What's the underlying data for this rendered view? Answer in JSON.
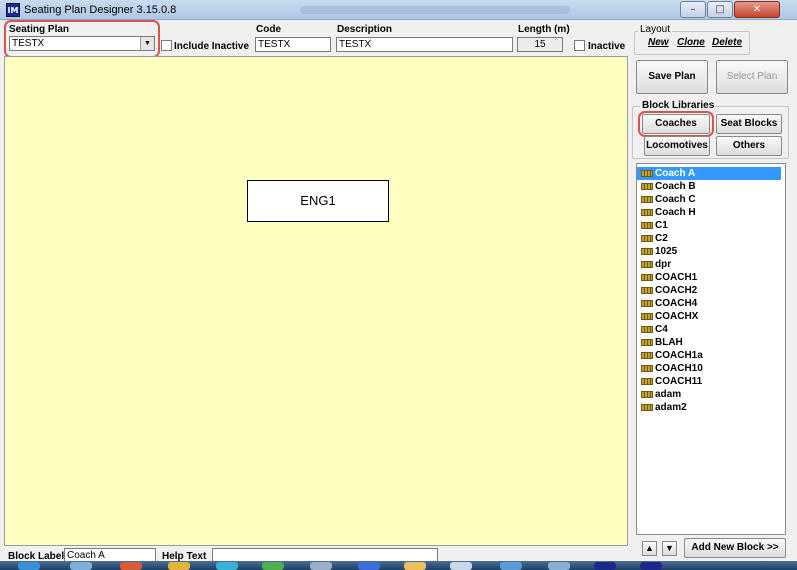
{
  "window": {
    "title": "Seating Plan Designer  3.15.0.8",
    "controls": {
      "minimize": "–",
      "maximize": "□",
      "close": "✕"
    }
  },
  "header": {
    "seating_plan_label": "Seating Plan",
    "seating_plan_value": "TESTX",
    "include_inactive_label": "Include Inactive",
    "code_label": "Code",
    "code_value": "TESTX",
    "description_label": "Description",
    "description_value": "TESTX",
    "length_label": "Length (m)",
    "length_value": "15",
    "inactive_label": "Inactive"
  },
  "layout_group": {
    "legend": "Layout",
    "new": "New",
    "clone": "Clone",
    "delete": "Delete"
  },
  "canvas": {
    "blocks": [
      {
        "label": "ENG1"
      }
    ]
  },
  "actions": {
    "save_plan": "Save Plan",
    "select_plan": "Select Plan"
  },
  "block_libraries": {
    "legend": "Block Libraries",
    "coaches": "Coaches",
    "seat_blocks": "Seat Blocks",
    "locomotives": "Locomotives",
    "others": "Others",
    "items": [
      "Coach A",
      "Coach B",
      "Coach C",
      "Coach H",
      "C1",
      "C2",
      "1025",
      "dpr",
      "COACH1",
      "COACH2",
      "COACH4",
      "COACHX",
      "C4",
      "BLAH",
      "COACH1a",
      "COACH10",
      "COACH11",
      "adam",
      "adam2"
    ],
    "selected_index": 0
  },
  "footer": {
    "block_label_label": "Block Label",
    "block_label_value": "Coach A",
    "help_text_label": "Help Text",
    "help_text_value": "",
    "add_new_block": "Add New Block >>",
    "move_up": "▲",
    "move_down": "▼"
  },
  "colors": {
    "canvas_bg": "#ffffc0",
    "highlight": "#d9534f",
    "selection": "#3399ff"
  }
}
